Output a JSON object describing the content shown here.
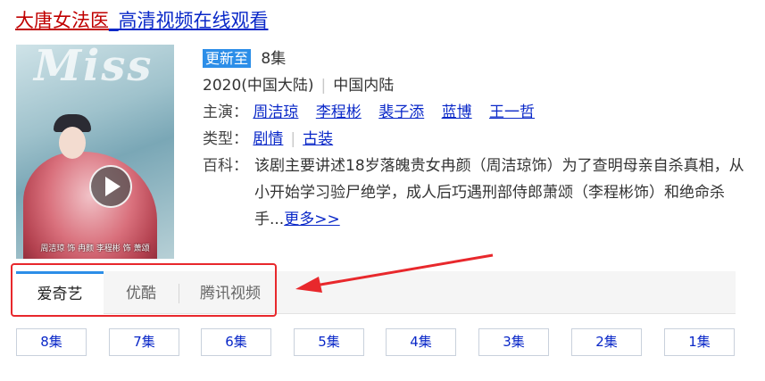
{
  "title": {
    "name": "大唐女法医",
    "suffix": "_高清视频在线观看"
  },
  "poster": {
    "watermark": "Miss",
    "credits": "周洁琼 饰 冉颜    李程彬 饰 萧颂"
  },
  "info": {
    "update_badge": "更新至",
    "episodes_count": "8集",
    "year_region": "2020(中国大陆)",
    "region2": "中国内陆",
    "cast_label": "主演：",
    "cast": [
      "周洁琼",
      "李程彬",
      "裴子添",
      "蓝博",
      "王一哲"
    ],
    "genre_label": "类型：",
    "genres": [
      "剧情",
      "古装"
    ],
    "intro_label": "百科：",
    "intro_text": "该剧主要讲述18岁落魄贵女冉颜（周洁琼饰）为了查明母亲自杀真相，从小开始学习验尸绝学，成人后巧遇刑部侍郎萧颂（李程彬饰）和绝命杀手...",
    "more_link": "更多>>"
  },
  "tabs": [
    "爱奇艺",
    "优酷",
    "腾讯视频"
  ],
  "active_tab": 0,
  "episodes": [
    "8集",
    "7集",
    "6集",
    "5集",
    "4集",
    "3集",
    "2集",
    "1集"
  ],
  "annotation": {
    "color": "#e8282c"
  }
}
